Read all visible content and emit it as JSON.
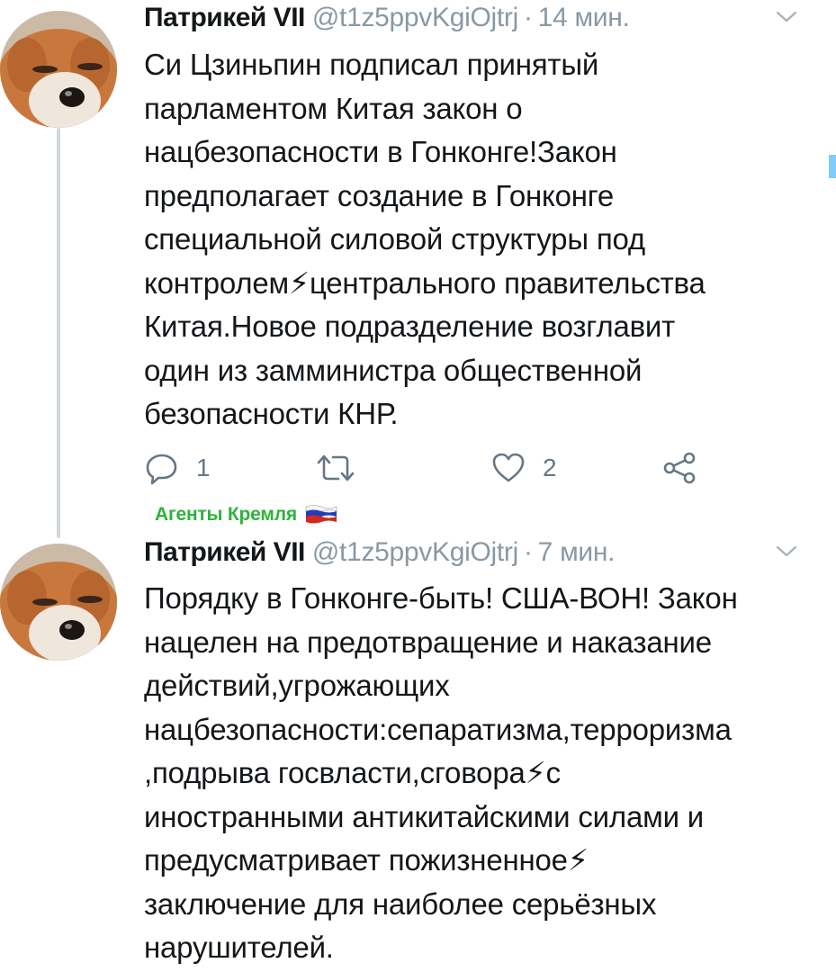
{
  "tweets": [
    {
      "name": "Патрикей VII",
      "handle": "@t1z5ppvKgiOjtrj",
      "separator": "·",
      "time": "14 мин.",
      "text": "Си Цзиньпин подписал принятый\nпарламентом Китая закон о\nнацбезопасности в Гонконге!Закон\nпредполагает создание в Гонконге\nспециальной силовой структуры под\nконтролем⚡центрального правительства\nКитая.Новое подразделение возглавит\nодин из замминистра общественной\nбезопасности КНР.",
      "reply_count": "1",
      "retweet_count": "",
      "like_count": "2"
    },
    {
      "name": "Патрикей VII",
      "handle": "@t1z5ppvKgiOjtrj",
      "separator": "·",
      "time": "7 мин.",
      "text": "Порядку в Гонконге-быть! США-ВОН! Закон\nнацелен на предотвращение и наказание\nдействий,угрожающих\nнацбезопасности:сепаратизма,терроризма\n,подрыва госвласти,сговора⚡с\nиностранными антикитайскими силами и\nпредусматривает пожизненное⚡\nзаключение для наиболее серьёзных\nнарушителей."
    }
  ],
  "group_label": "Агенты Кремля",
  "icons": {
    "avatar": "fox-avatar-icon",
    "chevron": "chevron-down-icon",
    "reply": "reply-icon",
    "retweet": "retweet-icon",
    "like": "heart-icon",
    "share": "share-icon",
    "flag": "russia-flag-icon"
  },
  "colors": {
    "text": "#14171a",
    "muted": "#8899a6",
    "group_label": "#2fb23c",
    "thread_line": "#cfd9de"
  }
}
